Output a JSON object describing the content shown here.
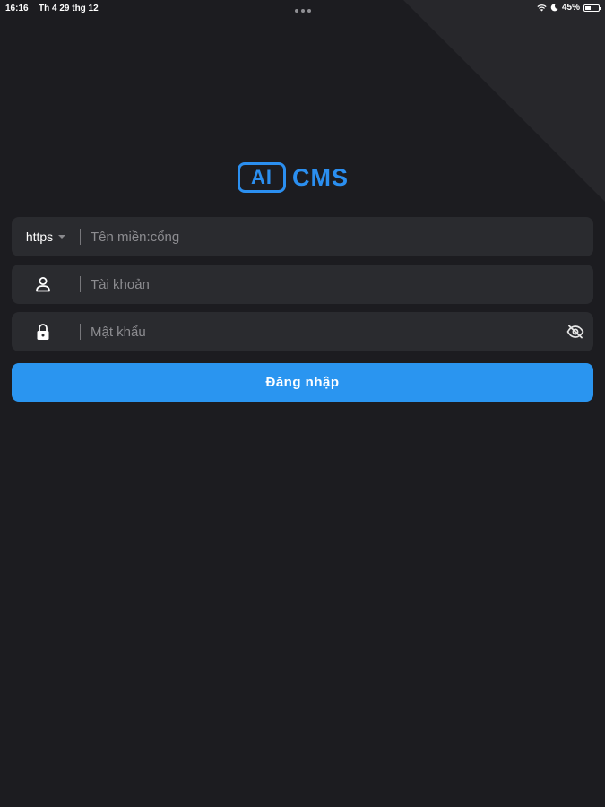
{
  "status_bar": {
    "time": "16:16",
    "date": "Th 4 29 thg 12",
    "battery_percent_text": "45%",
    "battery_level": 0.45,
    "icons": [
      "wifi-icon",
      "moon-icon",
      "battery-icon"
    ]
  },
  "logo": {
    "ai_text": "AI",
    "cms_text": "CMS",
    "color": "#2b8ff0"
  },
  "domain_field": {
    "protocol": "https",
    "placeholder": "Tên miền:cổng",
    "value": ""
  },
  "username_field": {
    "icon": "user-icon",
    "placeholder": "Tài khoản",
    "value": ""
  },
  "password_field": {
    "icon": "lock-icon",
    "toggle_icon": "eye-off-icon",
    "placeholder": "Mật khẩu",
    "value": ""
  },
  "login_button": {
    "label": "Đăng nhập",
    "color": "#2a95f0"
  },
  "theme": {
    "background": "#1c1c20",
    "field_background": "#2a2b2f"
  }
}
